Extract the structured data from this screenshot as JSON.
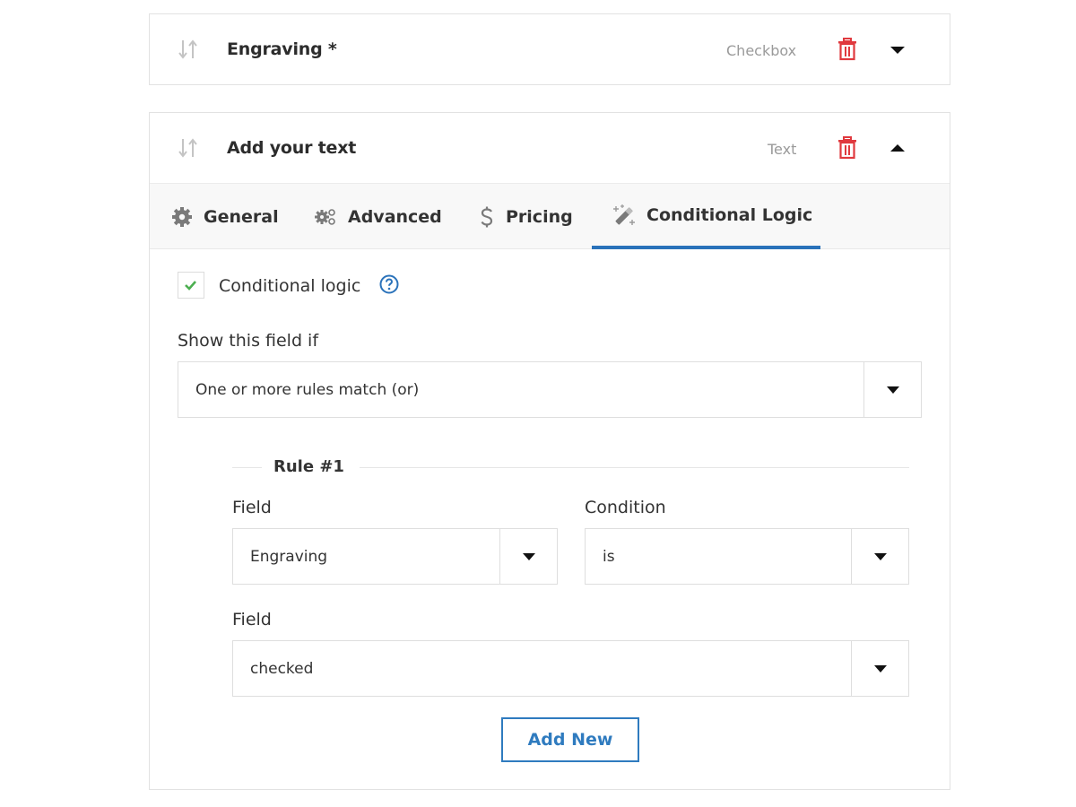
{
  "fields": [
    {
      "title": "Engraving *",
      "type_label": "Checkbox",
      "expanded": false
    },
    {
      "title": "Add your text",
      "type_label": "Text",
      "expanded": true,
      "tabs": [
        {
          "label": "General",
          "icon": "gear-icon",
          "active": false
        },
        {
          "label": "Advanced",
          "icon": "gears-icon",
          "active": false
        },
        {
          "label": "Pricing",
          "icon": "dollar-icon",
          "active": false
        },
        {
          "label": "Conditional Logic",
          "icon": "magic-wand-icon",
          "active": true
        }
      ],
      "conditional_logic": {
        "checkbox_label": "Conditional logic",
        "checked": true,
        "show_if_label": "Show this field if",
        "show_if_value": "One or more rules match (or)",
        "rules": [
          {
            "title": "Rule #1",
            "field_label": "Field",
            "field_value": "Engraving",
            "condition_label": "Condition",
            "condition_value": "is",
            "value_label": "Field",
            "value_value": "checked"
          }
        ],
        "add_button_label": "Add New"
      }
    }
  ],
  "colors": {
    "accent": "#2a72ba",
    "delete": "#e0393e",
    "check": "#4caf50",
    "muted_text": "#9a9a9a"
  }
}
